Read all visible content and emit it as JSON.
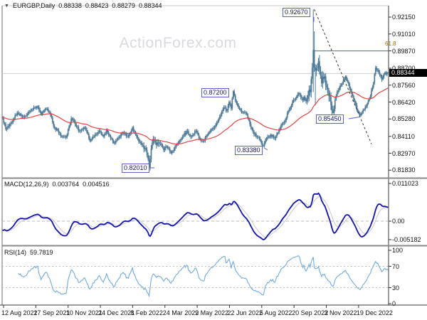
{
  "header": {
    "dropdown_icon": "▼",
    "symbol": "EURGBP,Daily",
    "open": "0.88338",
    "high": "0.88423",
    "low": "0.88279",
    "close": "0.88344"
  },
  "watermark": "ActionForex.com",
  "colors": {
    "candle": "#4a7898",
    "ma_line": "#e94040",
    "macd_line": "#1212b4",
    "signal_line": "#c8c8c8",
    "rsi_line": "#72abdf",
    "label_box_border": "#5d5dd5",
    "label_text": "#14145e",
    "fib_line": "#46708e",
    "fib_text": "#8a7400",
    "current_price_line": "#cfcfcf",
    "tag_bg": "#000000",
    "tag_text": "#ffffff",
    "watermark": "#d8dade",
    "trendline": "#333333"
  },
  "price_axis": {
    "labels": [
      [
        "0.92150",
        0.9215
      ],
      [
        "0.91010",
        0.9101
      ],
      [
        "0.89870",
        0.8987
      ],
      [
        "0.88700",
        0.887
      ],
      [
        "0.87560",
        0.8756
      ],
      [
        "0.86420",
        0.8642
      ],
      [
        "0.85280",
        0.8528
      ],
      [
        "0.84110",
        0.8411
      ],
      [
        "0.82970",
        0.8297
      ],
      [
        "0.81830",
        0.8183
      ]
    ],
    "current": "0.88344"
  },
  "macd_panel": {
    "title": "MACD(12,26,9)",
    "macd_value": "0.003764",
    "signal_value": "0.004516",
    "axis": [
      [
        "0.011023",
        258
      ],
      [
        "0.00",
        311
      ],
      [
        "-0.005182",
        337
      ]
    ]
  },
  "rsi_panel": {
    "title": "RSI(14)",
    "value": "59.7819",
    "axis": [
      [
        "100",
        100
      ],
      [
        "70",
        70
      ],
      [
        "30",
        30
      ],
      [
        "0",
        0
      ]
    ],
    "guide_levels": [
      70,
      30
    ]
  },
  "date_axis": [
    "12 Aug 2021",
    "27 Sep 2021",
    "10 Nov 2021",
    "24 Dec 2021",
    "8 Feb 2022",
    "24 Mar 2022",
    "9 May 2022",
    "22 Jun 2022",
    "5 Aug 2022",
    "20 Sep 2022",
    "3 Nov 2022",
    "19 Dec 2022"
  ],
  "annotations": [
    {
      "text": "0.92670"
    },
    {
      "text": "0.87200"
    },
    {
      "text": "0.82010"
    },
    {
      "text": "0.83380"
    },
    {
      "text": "0.85450"
    }
  ],
  "fib_label": "61.8",
  "chart_data": {
    "type": "candlestick",
    "symbol": "EURGBP",
    "timeframe": "Daily",
    "bars": 372,
    "ylim": [
      0.8141,
      0.9287
    ],
    "last_close": 0.88344,
    "current_price": 0.88344,
    "fib_level": 0.8987,
    "marked_levels": {
      "spike_high": 0.9267,
      "june_high": 0.872,
      "march_low": 0.8201,
      "august_low": 0.8338,
      "december_low": 0.8545
    },
    "trendline": {
      "from_bar": 300,
      "from_price": 0.9267,
      "to_bar": 355,
      "to_price": 0.836
    },
    "indicators": {
      "ma": {
        "type": "EMA",
        "period": 55
      },
      "macd": {
        "fast": 12,
        "slow": 26,
        "signal": 9,
        "value": 0.003764,
        "signal_value": 0.004516,
        "range": [
          -0.005182,
          0.011023
        ]
      },
      "rsi": {
        "period": 14,
        "value": 59.7819,
        "range": [
          0,
          100
        ]
      }
    },
    "price_path": [
      [
        0,
        0.8535
      ],
      [
        3,
        0.8462
      ],
      [
        8,
        0.8498
      ],
      [
        14,
        0.8568
      ],
      [
        21,
        0.8542
      ],
      [
        27,
        0.8585
      ],
      [
        33,
        0.8612
      ],
      [
        37,
        0.856
      ],
      [
        42,
        0.8597
      ],
      [
        46,
        0.856
      ],
      [
        49,
        0.8478
      ],
      [
        53,
        0.845
      ],
      [
        56,
        0.8412
      ],
      [
        61,
        0.8402
      ],
      [
        66,
        0.8532
      ],
      [
        71,
        0.848
      ],
      [
        74,
        0.8445
      ],
      [
        79,
        0.8472
      ],
      [
        84,
        0.8378
      ],
      [
        89,
        0.842
      ],
      [
        93,
        0.8448
      ],
      [
        97,
        0.841
      ],
      [
        100,
        0.8452
      ],
      [
        104,
        0.84
      ],
      [
        107,
        0.8365
      ],
      [
        112,
        0.8405
      ],
      [
        116,
        0.8438
      ],
      [
        121,
        0.841
      ],
      [
        125,
        0.8472
      ],
      [
        128,
        0.842
      ],
      [
        131,
        0.838
      ],
      [
        134,
        0.8355
      ],
      [
        137,
        0.833
      ],
      [
        139,
        0.829
      ],
      [
        141,
        0.8205
      ],
      [
        143,
        0.833
      ],
      [
        145,
        0.839
      ],
      [
        148,
        0.8355
      ],
      [
        152,
        0.8362
      ],
      [
        155,
        0.832
      ],
      [
        158,
        0.8345
      ],
      [
        162,
        0.8296
      ],
      [
        166,
        0.834
      ],
      [
        170,
        0.838
      ],
      [
        174,
        0.8415
      ],
      [
        177,
        0.8446
      ],
      [
        180,
        0.842
      ],
      [
        182,
        0.8412
      ],
      [
        186,
        0.8448
      ],
      [
        189,
        0.84
      ],
      [
        193,
        0.838
      ],
      [
        197,
        0.842
      ],
      [
        200,
        0.8448
      ],
      [
        203,
        0.847
      ],
      [
        207,
        0.851
      ],
      [
        210,
        0.856
      ],
      [
        213,
        0.8608
      ],
      [
        216,
        0.8585
      ],
      [
        218,
        0.864
      ],
      [
        220,
        0.86
      ],
      [
        222,
        0.8715
      ],
      [
        224,
        0.865
      ],
      [
        227,
        0.8608
      ],
      [
        230,
        0.857
      ],
      [
        234,
        0.8572
      ],
      [
        237,
        0.852
      ],
      [
        241,
        0.844
      ],
      [
        245,
        0.8408
      ],
      [
        248,
        0.838
      ],
      [
        251,
        0.8345
      ],
      [
        254,
        0.8395
      ],
      [
        258,
        0.842
      ],
      [
        262,
        0.8398
      ],
      [
        266,
        0.8452
      ],
      [
        271,
        0.851
      ],
      [
        275,
        0.858
      ],
      [
        280,
        0.8655
      ],
      [
        283,
        0.868
      ],
      [
        285,
        0.8702
      ],
      [
        288,
        0.8665
      ],
      [
        291,
        0.866
      ],
      [
        294,
        0.869
      ],
      [
        296,
        0.8712
      ],
      [
        298,
        0.888
      ],
      [
        299,
        0.899
      ],
      [
        300,
        0.887
      ],
      [
        302,
        0.8872
      ],
      [
        304,
        0.892
      ],
      [
        306,
        0.882
      ],
      [
        307,
        0.877
      ],
      [
        309,
        0.88
      ],
      [
        310,
        0.882
      ],
      [
        312,
        0.874
      ],
      [
        314,
        0.868
      ],
      [
        316,
        0.862
      ],
      [
        318,
        0.8572
      ],
      [
        321,
        0.868
      ],
      [
        323,
        0.872
      ],
      [
        325,
        0.8752
      ],
      [
        328,
        0.879
      ],
      [
        330,
        0.8815
      ],
      [
        332,
        0.878
      ],
      [
        335,
        0.872
      ],
      [
        337,
        0.868
      ],
      [
        340,
        0.862
      ],
      [
        342,
        0.858
      ],
      [
        344,
        0.855
      ],
      [
        346,
        0.857
      ],
      [
        348,
        0.8592
      ],
      [
        351,
        0.863
      ],
      [
        354,
        0.868
      ],
      [
        356,
        0.874
      ],
      [
        359,
        0.8872
      ],
      [
        362,
        0.8845
      ],
      [
        365,
        0.8792
      ],
      [
        368,
        0.884
      ],
      [
        371,
        0.88344
      ]
    ],
    "extremes": {
      "33": {
        "high": 0.8618
      },
      "84": {
        "low": 0.8372
      },
      "107": {
        "low": 0.836
      },
      "141": {
        "low": 0.8201
      },
      "162": {
        "low": 0.8293
      },
      "222": {
        "high": 0.8721
      },
      "251": {
        "low": 0.8338
      },
      "299": {
        "high": 0.9267,
        "low": 0.871
      },
      "300": {
        "high": 0.9118
      },
      "301": {
        "low": 0.862
      },
      "318": {
        "low": 0.8565
      },
      "330": {
        "high": 0.8822
      },
      "344": {
        "low": 0.8545
      }
    }
  }
}
